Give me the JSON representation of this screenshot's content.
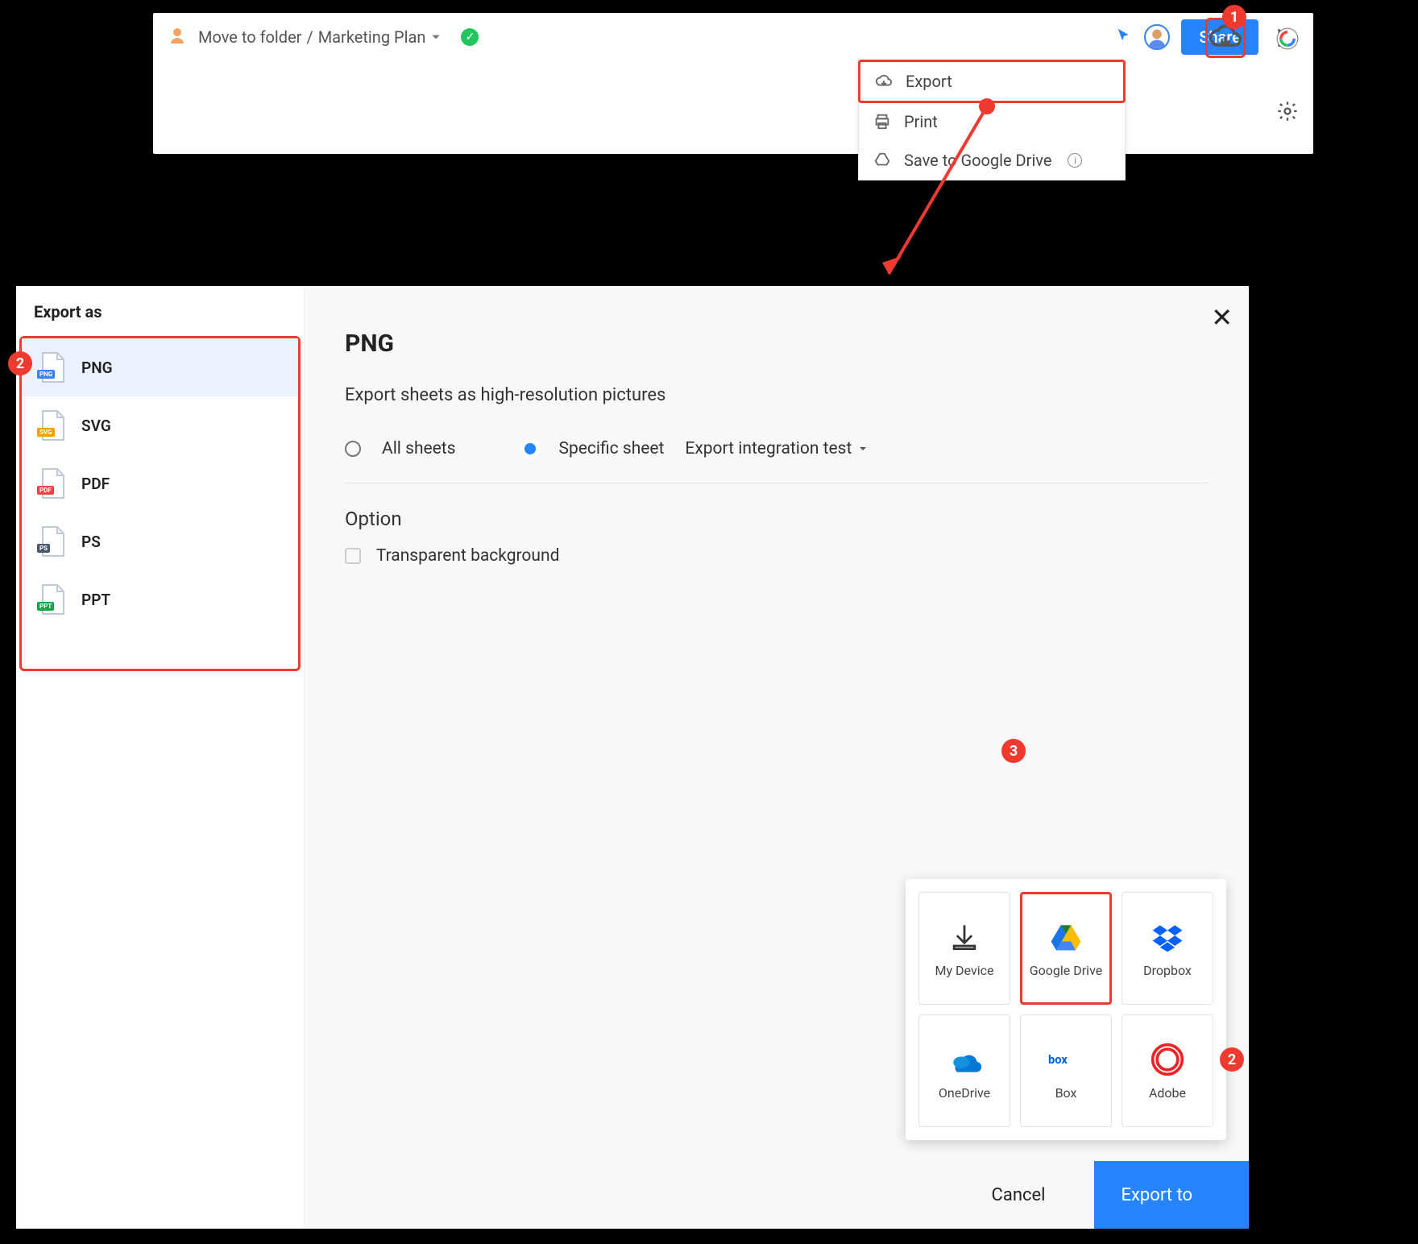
{
  "topbar": {
    "breadcrumb_parent": "Move to folder",
    "breadcrumb_current": "Marketing Plan",
    "share_label": "Share"
  },
  "menu": {
    "export": "Export",
    "print": "Print",
    "save_drive": "Save to Google Drive"
  },
  "callouts": {
    "one": "1",
    "two": "2",
    "three": "3",
    "footer_two": "2"
  },
  "dialog": {
    "sidebar_title": "Export as",
    "formats": [
      {
        "label": "PNG",
        "badge": "PNG",
        "color": "#3b82f6"
      },
      {
        "label": "SVG",
        "badge": "SVG",
        "color": "#f59e0b"
      },
      {
        "label": "PDF",
        "badge": "PDF",
        "color": "#ef4444"
      },
      {
        "label": "PS",
        "badge": "PS",
        "color": "#475569"
      },
      {
        "label": "PPT",
        "badge": "PPT",
        "color": "#16a34a"
      }
    ],
    "title": "PNG",
    "subtitle": "Export sheets as high-resolution pictures",
    "radio_all": "All sheets",
    "radio_specific": "Specific sheet",
    "sheet_name": "Export integration test",
    "option_heading": "Option",
    "transparent_label": "Transparent background",
    "targets": [
      "My Device",
      "Google Drive",
      "Dropbox",
      "OneDrive",
      "Box",
      "Adobe"
    ],
    "cancel": "Cancel",
    "export_to": "Export to"
  }
}
